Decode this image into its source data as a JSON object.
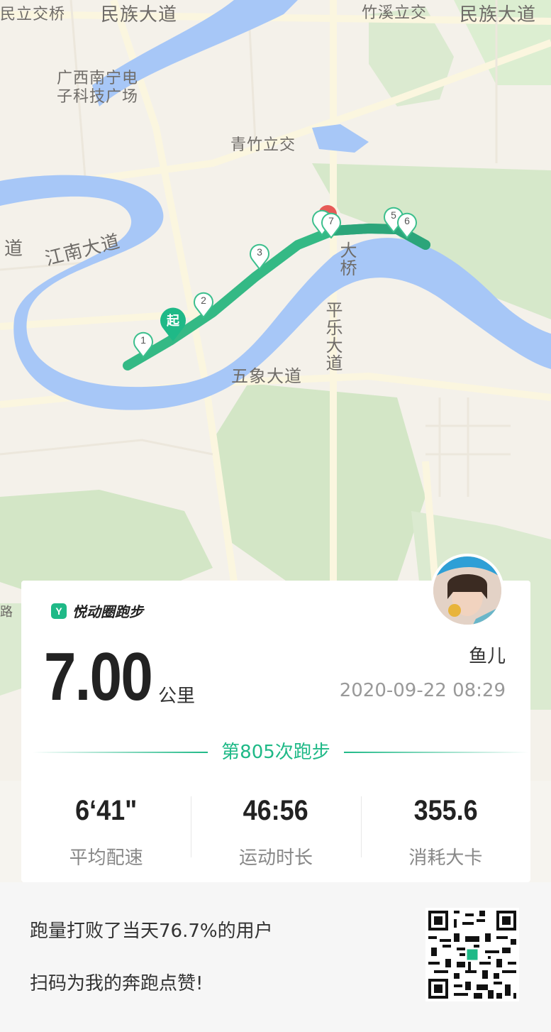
{
  "map": {
    "labels": [
      "民立交桥",
      "民族大道",
      "竹溪立交",
      "民族大道",
      "广西南宁电",
      "子科技广场",
      "青竹立交",
      "江南大道",
      "道",
      "大桥",
      "平乐大道",
      "五象大道",
      "路"
    ],
    "start_label": "起",
    "kilometer_markers": [
      "1",
      "2",
      "3",
      "5",
      "6",
      "7"
    ]
  },
  "card": {
    "brand": "悦动圈跑步",
    "brand_logo": "Y",
    "distance": "7.00",
    "unit": "公里",
    "username": "鱼儿",
    "datetime": "2020-09-22 08:29",
    "run_count": "第805次跑步",
    "stats": [
      {
        "value": "6‘41\"",
        "label": "平均配速"
      },
      {
        "value": "46:56",
        "label": "运动时长"
      },
      {
        "value": "355.6",
        "label": "消耗大卡"
      }
    ]
  },
  "footer": {
    "beat_text": "跑量打败了当天76.7%的用户",
    "scan_text": "扫码为我的奔跑点赞!"
  },
  "colors": {
    "accent": "#1fb987",
    "river": "#a7c7f7",
    "park": "#cfe5c3"
  }
}
